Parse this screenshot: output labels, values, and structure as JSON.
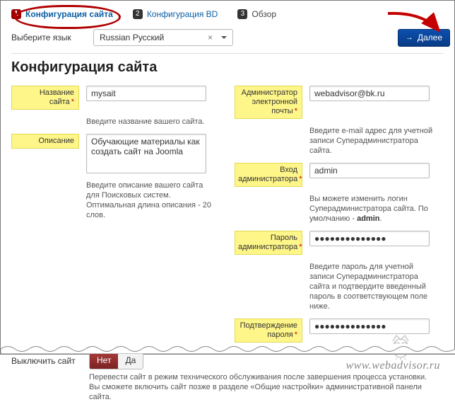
{
  "steps": {
    "s1": {
      "num": "1",
      "label": "Конфигурация сайта"
    },
    "s2": {
      "num": "2",
      "label": "Конфигурация BD"
    },
    "s3": {
      "num": "3",
      "label": "Обзор"
    }
  },
  "language": {
    "label": "Выберите язык",
    "value": "Russian Русский"
  },
  "next_label": "Далее",
  "heading": "Конфигурация сайта",
  "left": {
    "site_name": {
      "label": "Название сайта",
      "value": "mysait",
      "help": "Введите название вашего сайта."
    },
    "description": {
      "label": "Описание",
      "value": "Обучающие материалы как создать сайт на Joomla",
      "help": "Введите описание вашего сайта для Поисковых систем. Оптимальная длина описания - 20 слов."
    }
  },
  "right": {
    "admin_email": {
      "label": "Администратор электронной почты",
      "value": "webadvisor@bk.ru",
      "help": "Введите e-mail адрес для учетной записи Суперадминистратора сайта."
    },
    "admin_login": {
      "label": "Вход администратора",
      "value": "admin",
      "help_prefix": "Вы можете изменить логин Суперадминистратора сайта. По умолчанию - ",
      "help_bold": "admin",
      "help_suffix": "."
    },
    "admin_pass": {
      "label": "Пароль администратора",
      "value": "●●●●●●●●●●●●●●",
      "help": "Введите пароль для учетной записи Суперадминистратора сайта и подтвердите введенный пароль в соответствующем поле ниже."
    },
    "admin_pass2": {
      "label": "Подтверждение пароля",
      "value": "●●●●●●●●●●●●●●"
    }
  },
  "offline": {
    "label": "Выключить сайт",
    "no": "Нет",
    "yes": "Да"
  },
  "bottom_help": "Перевести сайт в режим технического обслуживания после завершения процесса установки. Вы сможете включить сайт позже в разделе «Общие настройки» административной панели сайта.",
  "watermark": "www.webadvisor.ru"
}
